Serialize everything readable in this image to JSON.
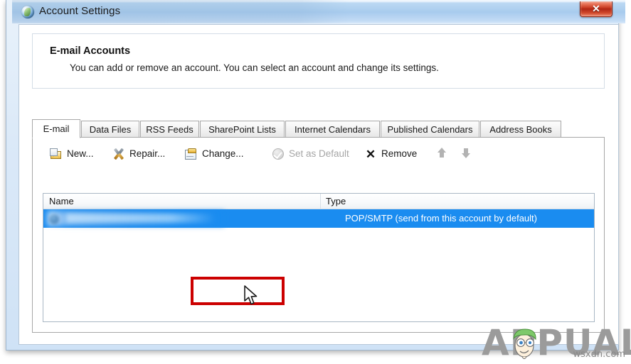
{
  "window": {
    "title": "Account Settings",
    "app_icon": "globe-icon",
    "close_label": "✕"
  },
  "header": {
    "title": "E-mail Accounts",
    "description": "You can add or remove an account. You can select an account and change its settings."
  },
  "tabs": [
    {
      "label": "E-mail",
      "active": true
    },
    {
      "label": "Data Files",
      "active": false
    },
    {
      "label": "RSS Feeds",
      "active": false
    },
    {
      "label": "SharePoint Lists",
      "active": false
    },
    {
      "label": "Internet Calendars",
      "active": false
    },
    {
      "label": "Published Calendars",
      "active": false
    },
    {
      "label": "Address Books",
      "active": false
    }
  ],
  "toolbar": {
    "new_label": "New...",
    "repair_label": "Repair...",
    "change_label": "Change...",
    "set_default_label": "Set as Default",
    "remove_label": "Remove",
    "move_up_label": "",
    "move_down_label": "",
    "highlight_color": "#cc0000",
    "highlighted_button": "change-button"
  },
  "accounts_table": {
    "columns": [
      "Name",
      "Type"
    ],
    "rows": [
      {
        "name": "",
        "name_redacted": true,
        "type": "POP/SMTP (send from this account by default)",
        "selected": true
      }
    ],
    "selection_color": "#1a8cf0"
  },
  "watermarks": {
    "brand": "APPUALS",
    "site": "wsxdn.com"
  }
}
